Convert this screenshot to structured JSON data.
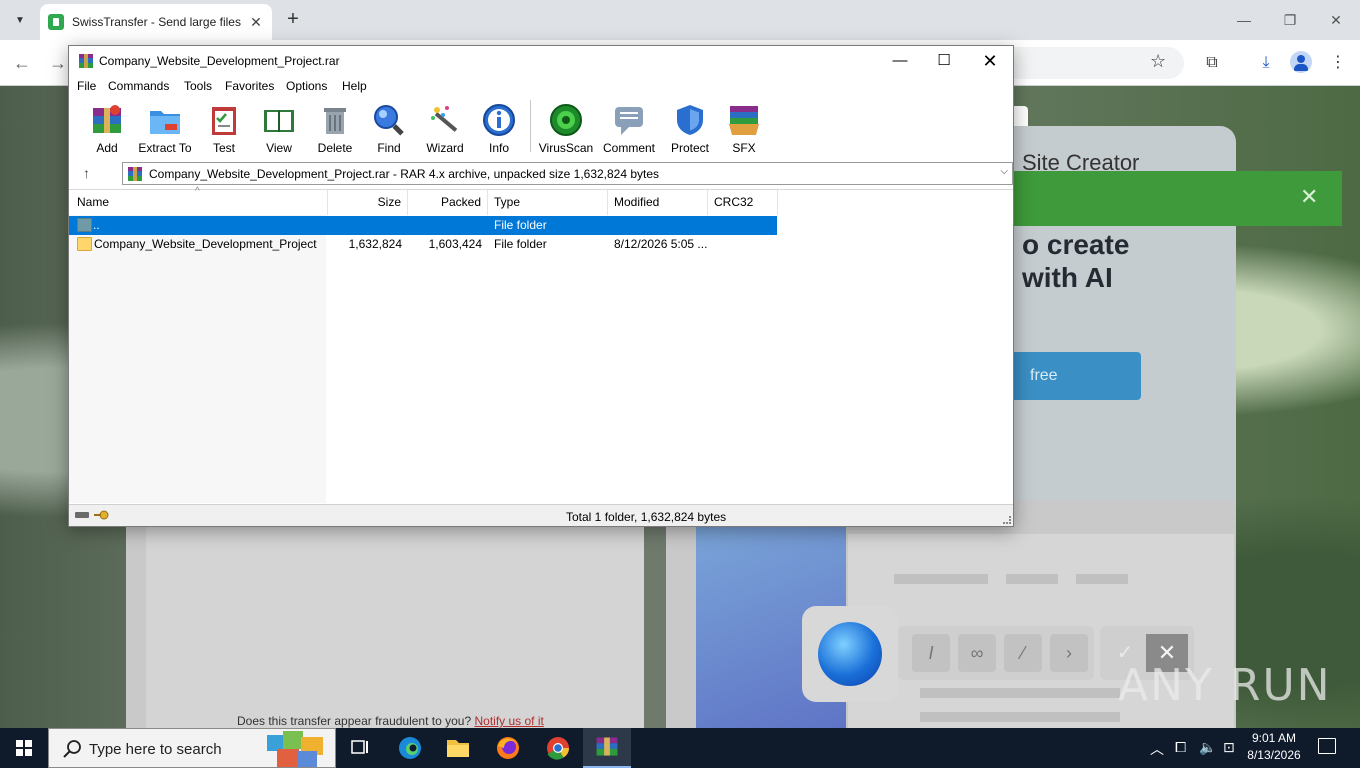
{
  "browser": {
    "tab_title": "SwissTransfer - Send large files",
    "new_tab_symbol": "+"
  },
  "page_behind": {
    "creator_title": "Site Creator",
    "headline_line1": "o create",
    "headline_line2": "with AI",
    "cta_label": "free",
    "fraud_question": "Does this transfer appear fraudulent to you?",
    "fraud_link": "Notify us of it",
    "watermark": "ANY RUN"
  },
  "winrar": {
    "title": "Company_Website_Development_Project.rar",
    "menu": [
      "File",
      "Commands",
      "Tools",
      "Favorites",
      "Options",
      "Help"
    ],
    "toolbar": [
      {
        "label": "Add",
        "icon": "archive-add-icon"
      },
      {
        "label": "Extract To",
        "icon": "folder-extract-icon"
      },
      {
        "label": "Test",
        "icon": "clipboard-test-icon"
      },
      {
        "label": "View",
        "icon": "book-view-icon"
      },
      {
        "label": "Delete",
        "icon": "trash-icon"
      },
      {
        "label": "Find",
        "icon": "magnifier-icon"
      },
      {
        "label": "Wizard",
        "icon": "magic-wand-icon"
      },
      {
        "label": "Info",
        "icon": "info-icon"
      },
      {
        "label": "VirusScan",
        "icon": "virus-scan-icon"
      },
      {
        "label": "Comment",
        "icon": "comment-icon"
      },
      {
        "label": "Protect",
        "icon": "shield-icon"
      },
      {
        "label": "SFX",
        "icon": "sfx-box-icon"
      }
    ],
    "path": "Company_Website_Development_Project.rar - RAR 4.x archive, unpacked size 1,632,824 bytes",
    "columns": [
      "Name",
      "Size",
      "Packed",
      "Type",
      "Modified",
      "CRC32"
    ],
    "rows": [
      {
        "name": "..",
        "size": "",
        "packed": "",
        "type": "File folder",
        "modified": "",
        "crc": "",
        "selected": true
      },
      {
        "name": "Company_Website_Development_Project",
        "size": "1,632,824",
        "packed": "1,603,424",
        "type": "File folder",
        "modified": "8/12/2026 5:05 ...",
        "crc": "",
        "selected": false
      }
    ],
    "status": "Total 1 folder, 1,632,824 bytes"
  },
  "taskbar": {
    "search_placeholder": "Type here to search",
    "time": "9:01 AM",
    "date": "8/13/2026"
  },
  "colors": {
    "selection": "#0078d7",
    "taskbar": "#0f1a2b",
    "banner_green": "#3e9a3a"
  }
}
